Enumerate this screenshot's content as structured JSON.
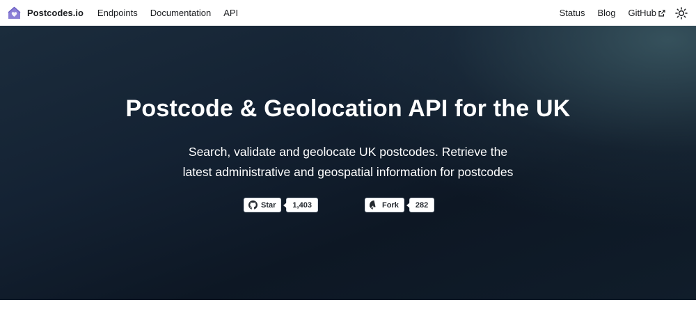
{
  "navbar": {
    "brand": "Postcodes.io",
    "left_links": [
      "Endpoints",
      "Documentation",
      "API"
    ],
    "right_links": {
      "status": "Status",
      "blog": "Blog",
      "github": "GitHub"
    }
  },
  "hero": {
    "title": "Postcode & Geolocation API for the UK",
    "subtitle_line1": "Search, validate and geolocate UK postcodes. Retrieve the",
    "subtitle_line2": "latest administrative and geospatial information for postcodes"
  },
  "github_buttons": {
    "star": {
      "label": "Star",
      "count": "1,403"
    },
    "fork": {
      "label": "Fork",
      "count": "282"
    }
  },
  "icons": {
    "logo": "house-logo-icon",
    "external": "external-link-icon",
    "theme": "sun-icon",
    "github": "github-mark-icon"
  },
  "colors": {
    "brand_logo": "#8b7fd6",
    "hero_dark": "#0d1724",
    "hero_light": "#3c5a64"
  }
}
